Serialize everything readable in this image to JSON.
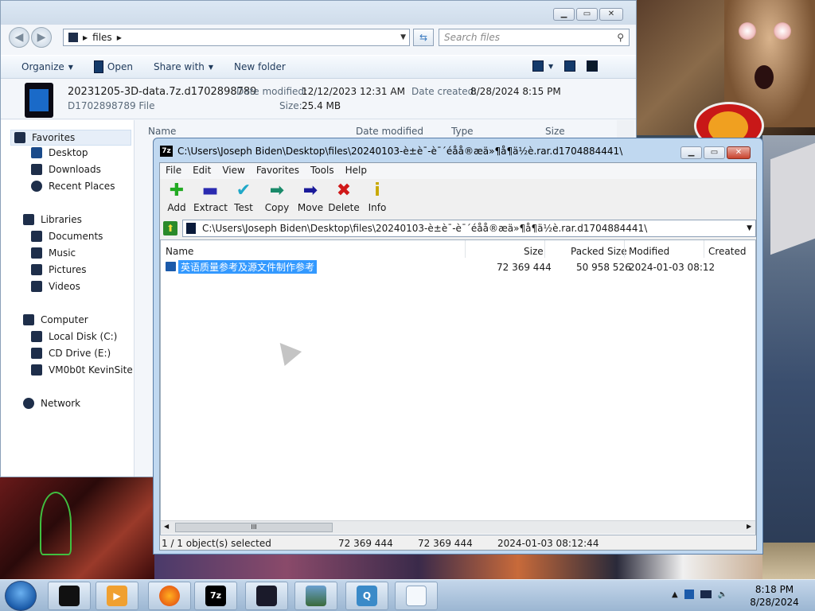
{
  "explorer": {
    "breadcrumb": "files",
    "search_placeholder": "Search files",
    "commands": {
      "organize": "Organize",
      "open": "Open",
      "share_with": "Share with",
      "new_folder": "New folder"
    },
    "details": {
      "filename": "20231205-3D-data.7z.d1702898789",
      "filetype": "D1702898789 File",
      "modified_label": "Date modified:",
      "modified_value": "12/12/2023 12:31 AM",
      "created_label": "Date created:",
      "created_value": "8/28/2024 8:15 PM",
      "size_label": "Size:",
      "size_value": "25.4 MB"
    },
    "columns": {
      "name": "Name",
      "date_modified": "Date modified",
      "type": "Type",
      "size": "Size"
    },
    "nav": {
      "favorites": "Favorites",
      "desktop": "Desktop",
      "downloads": "Downloads",
      "recent": "Recent Places",
      "libraries": "Libraries",
      "documents": "Documents",
      "music": "Music",
      "pictures": "Pictures",
      "videos": "Videos",
      "computer": "Computer",
      "local_disk": "Local Disk (C:)",
      "cd_drive": "CD Drive (E:)",
      "vm": "VM0b0t KevinSite",
      "network": "Network"
    }
  },
  "sevenzip": {
    "icon_label": "7z",
    "title": "C:\\Users\\Joseph Biden\\Desktop\\files\\20240103-è±è¯-è¯´éåå®æä»¶å¶ä½è.rar.d1704884441\\",
    "menu": [
      "File",
      "Edit",
      "View",
      "Favorites",
      "Tools",
      "Help"
    ],
    "toolbar": [
      {
        "label": "Add",
        "glyph": "✚",
        "color": "#22aa22"
      },
      {
        "label": "Extract",
        "glyph": "▬",
        "color": "#2a2ab0"
      },
      {
        "label": "Test",
        "glyph": "✔",
        "color": "#20a8c8"
      },
      {
        "label": "Copy",
        "glyph": "➡",
        "color": "#1a8a6a"
      },
      {
        "label": "Move",
        "glyph": "➡",
        "color": "#1a1a9a"
      },
      {
        "label": "Delete",
        "glyph": "✖",
        "color": "#d01818"
      },
      {
        "label": "Info",
        "glyph": "i",
        "color": "#c8a800"
      }
    ],
    "path": "C:\\Users\\Joseph Biden\\Desktop\\files\\20240103-è±è¯-è¯´éåå®æä»¶å¶ä½è.rar.d1704884441\\",
    "columns": {
      "name": "Name",
      "size": "Size",
      "packed": "Packed Size",
      "modified": "Modified",
      "created": "Created"
    },
    "rows": [
      {
        "name": "英语质量参考及源文件制作参考",
        "size": "72 369 444",
        "packed": "50 958 526",
        "modified": "2024-01-03 08:12"
      }
    ],
    "status": {
      "selected": "1 / 1 object(s) selected",
      "size": "72 369 444",
      "size2": "72 369 444",
      "date": "2024-01-03 08:12:44"
    }
  },
  "taskbar": {
    "time": "8:18 PM",
    "date": "8/28/2024",
    "items": [
      "media-icon",
      "player-icon",
      "firefox-icon",
      "7zip-icon",
      "monitor-icon",
      "photo-icon",
      "app-icon",
      "document-icon"
    ]
  }
}
